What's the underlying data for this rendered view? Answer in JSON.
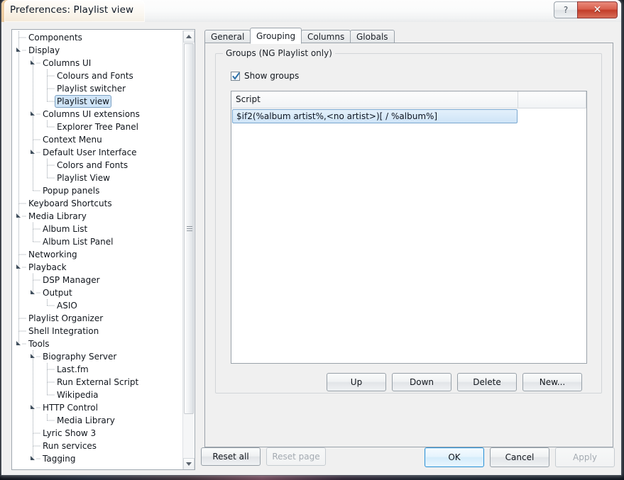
{
  "window": {
    "title": "Preferences: Playlist view",
    "help_button": "?",
    "close_button": "✕",
    "help_icon_name": "help-icon",
    "close_icon_name": "close-icon"
  },
  "tree": {
    "items": [
      {
        "label": "Components",
        "depth": 0,
        "marker": "leaf",
        "selected": false
      },
      {
        "label": "Display",
        "depth": 0,
        "marker": "expanded",
        "selected": false
      },
      {
        "label": "Columns UI",
        "depth": 1,
        "marker": "expanded",
        "selected": false
      },
      {
        "label": "Colours and Fonts",
        "depth": 2,
        "marker": "leaf",
        "selected": false
      },
      {
        "label": "Playlist switcher",
        "depth": 2,
        "marker": "leaf",
        "selected": false
      },
      {
        "label": "Playlist view",
        "depth": 2,
        "marker": "leaf",
        "selected": true
      },
      {
        "label": "Columns UI extensions",
        "depth": 1,
        "marker": "expanded",
        "selected": false
      },
      {
        "label": "Explorer Tree Panel",
        "depth": 2,
        "marker": "leaf",
        "selected": false
      },
      {
        "label": "Context Menu",
        "depth": 1,
        "marker": "leaf",
        "selected": false
      },
      {
        "label": "Default User Interface",
        "depth": 1,
        "marker": "expanded",
        "selected": false
      },
      {
        "label": "Colors and Fonts",
        "depth": 2,
        "marker": "leaf",
        "selected": false
      },
      {
        "label": "Playlist View",
        "depth": 2,
        "marker": "leaf",
        "selected": false
      },
      {
        "label": "Popup panels",
        "depth": 1,
        "marker": "leaf",
        "selected": false
      },
      {
        "label": "Keyboard Shortcuts",
        "depth": 0,
        "marker": "leaf",
        "selected": false
      },
      {
        "label": "Media Library",
        "depth": 0,
        "marker": "expanded",
        "selected": false
      },
      {
        "label": "Album List",
        "depth": 1,
        "marker": "leaf",
        "selected": false
      },
      {
        "label": "Album List Panel",
        "depth": 1,
        "marker": "leaf",
        "selected": false
      },
      {
        "label": "Networking",
        "depth": 0,
        "marker": "leaf",
        "selected": false
      },
      {
        "label": "Playback",
        "depth": 0,
        "marker": "expanded",
        "selected": false
      },
      {
        "label": "DSP Manager",
        "depth": 1,
        "marker": "leaf",
        "selected": false
      },
      {
        "label": "Output",
        "depth": 1,
        "marker": "expanded",
        "selected": false
      },
      {
        "label": "ASIO",
        "depth": 2,
        "marker": "leaf",
        "selected": false
      },
      {
        "label": "Playlist Organizer",
        "depth": 0,
        "marker": "leaf",
        "selected": false
      },
      {
        "label": "Shell Integration",
        "depth": 0,
        "marker": "leaf",
        "selected": false
      },
      {
        "label": "Tools",
        "depth": 0,
        "marker": "expanded",
        "selected": false
      },
      {
        "label": "Biography Server",
        "depth": 1,
        "marker": "expanded",
        "selected": false
      },
      {
        "label": "Last.fm",
        "depth": 2,
        "marker": "leaf",
        "selected": false
      },
      {
        "label": "Run External Script",
        "depth": 2,
        "marker": "leaf",
        "selected": false
      },
      {
        "label": "Wikipedia",
        "depth": 2,
        "marker": "leaf",
        "selected": false
      },
      {
        "label": "HTTP Control",
        "depth": 1,
        "marker": "expanded",
        "selected": false
      },
      {
        "label": "Media Library",
        "depth": 2,
        "marker": "leaf",
        "selected": false
      },
      {
        "label": "Lyric Show 3",
        "depth": 1,
        "marker": "leaf",
        "selected": false
      },
      {
        "label": "Run services",
        "depth": 1,
        "marker": "leaf",
        "selected": false
      },
      {
        "label": "Tagging",
        "depth": 1,
        "marker": "expanded",
        "selected": false
      }
    ],
    "scrollbar": {
      "up_arrow": "▲",
      "down_arrow": "▼"
    }
  },
  "tabs": [
    {
      "label": "General",
      "active": false
    },
    {
      "label": "Grouping",
      "active": true
    },
    {
      "label": "Columns",
      "active": false
    },
    {
      "label": "Globals",
      "active": false
    }
  ],
  "groupbox": {
    "title": "Groups (NG Playlist only)",
    "checkbox": {
      "label": "Show groups",
      "checked": true
    }
  },
  "script_list": {
    "columns": [
      "Script",
      ""
    ],
    "rows": [
      {
        "script": "$if2(%album artist%,<no artist>)[ / %album%]",
        "selected": true
      }
    ]
  },
  "list_buttons": [
    {
      "label": "Up",
      "enabled": true
    },
    {
      "label": "Down",
      "enabled": true
    },
    {
      "label": "Delete",
      "enabled": true
    },
    {
      "label": "New...",
      "enabled": true
    }
  ],
  "dialog_buttons": {
    "reset_all": {
      "label": "Reset all",
      "enabled": true,
      "default": false
    },
    "reset_page": {
      "label": "Reset page",
      "enabled": false,
      "default": false
    },
    "ok": {
      "label": "OK",
      "enabled": true,
      "default": true
    },
    "cancel": {
      "label": "Cancel",
      "enabled": true,
      "default": false
    },
    "apply": {
      "label": "Apply",
      "enabled": false,
      "default": false
    }
  },
  "colors": {
    "selection_blue": "#cfe4f7",
    "selection_border": "#7aa7cf",
    "default_button_border": "#2f93d6",
    "close_button_red": "#c33d2a",
    "window_bg": "#f0f0f0"
  }
}
